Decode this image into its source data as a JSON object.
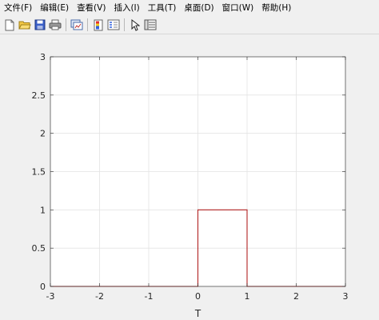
{
  "menubar": {
    "items": [
      "文件(F)",
      "编辑(E)",
      "查看(V)",
      "插入(I)",
      "工具(T)",
      "桌面(D)",
      "窗口(W)",
      "帮助(H)"
    ]
  },
  "toolbar": {
    "icons": [
      "new-file-icon",
      "open-file-icon",
      "save-icon",
      "print-icon",
      "link-plot-icon",
      "insert-colorbar-icon",
      "insert-legend-icon",
      "edit-plot-arrow-icon",
      "property-inspector-icon"
    ]
  },
  "chart_data": {
    "type": "line",
    "xlabel": "T",
    "ylabel": "",
    "title": "",
    "xlim": [
      -3,
      3
    ],
    "ylim": [
      0,
      3
    ],
    "xticks": [
      -3,
      -2,
      -1,
      0,
      1,
      2,
      3
    ],
    "yticks": [
      0,
      0.5,
      1,
      1.5,
      2,
      2.5,
      3
    ],
    "xtick_labels": [
      "-3",
      "-2",
      "-1",
      "0",
      "1",
      "2",
      "3"
    ],
    "ytick_labels": [
      "0",
      "0.5",
      "1",
      "1.5",
      "2",
      "2.5",
      "3"
    ],
    "grid": true,
    "series": [
      {
        "color": "#b22222",
        "x": [
          -3,
          0,
          0,
          1,
          1,
          3
        ],
        "y": [
          0,
          0,
          1,
          1,
          0,
          0
        ]
      }
    ]
  }
}
